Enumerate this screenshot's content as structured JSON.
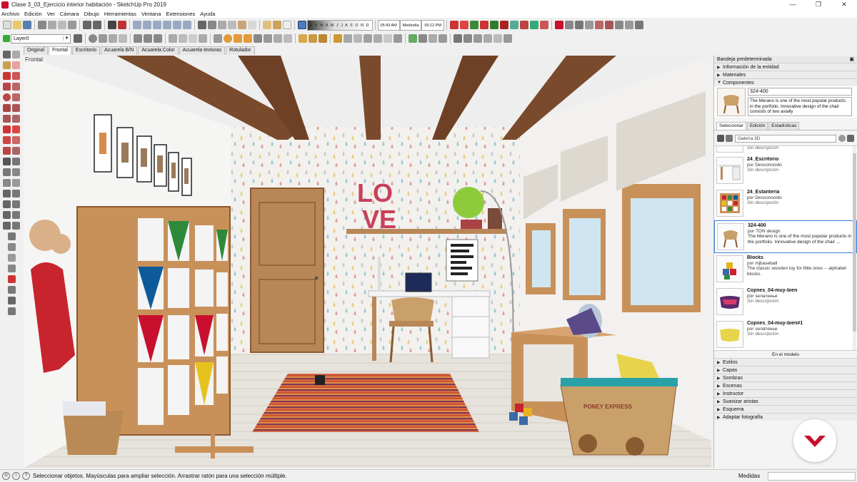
{
  "window": {
    "title": "Clase 3_03_Ejercicio interior habitación - SketchUp Pro 2019",
    "buttons": [
      "—",
      "❐",
      "✕"
    ]
  },
  "menu": [
    "Archivo",
    "Edición",
    "Ver",
    "Cámara",
    "Dibujo",
    "Herramientas",
    "Ventana",
    "Extensiones",
    "Ayuda"
  ],
  "shadows": {
    "months": "E F M A M J J A S O N D",
    "time_start": "05:43 AM",
    "time_mid": "Mediodía",
    "time_end": "06:12 PM"
  },
  "layer": {
    "value": "Layer0"
  },
  "style_tabs": [
    "Original",
    "Frontal",
    "Escritorio",
    "Acuarela B/N",
    "Acuarela Color",
    "Acuarela texturas",
    "Rotulador"
  ],
  "active_style_tab": "Frontal",
  "scene_label": "Frontal",
  "tray": {
    "title": "Bandeja predeterminada",
    "sections_top": [
      "Información de la entidad",
      "Materiales",
      "Componentes"
    ],
    "component": {
      "name": "324-400",
      "description": "The Merano is one of the most popular products in the portfolio. Innovative design of the chair consists of two axially"
    },
    "subtabs": [
      "Seleccionar",
      "Edición",
      "Estadísticas"
    ],
    "active_subtab": "Seleccionar",
    "search_placeholder": "Galería 3D",
    "items": [
      {
        "name": "",
        "author": "",
        "desc": "Sin descripción"
      },
      {
        "name": "24_Escritorio",
        "author": "por Desconocido",
        "desc": "Sin descripción"
      },
      {
        "name": "24_Estantería",
        "author": "por Desconocido",
        "desc": "Sin descripción"
      },
      {
        "name": "324-400",
        "author": "por TON design",
        "desc": "The Merano is one of the most popular products in the portfolio. Innovative design of the chair ..."
      },
      {
        "name": "Blocks",
        "author": "por mjbaseball",
        "desc": "The classic wooden toy for little ones -- alphabet blocks."
      },
      {
        "name": "Cojines_04-muy-bien",
        "author": "por seлатенье",
        "desc": "Sin descripción"
      },
      {
        "name": "Cojines_04-muy-bien#1",
        "author": "por seлатенье",
        "desc": "Sin descripción"
      }
    ],
    "footer": "En el modelo",
    "sections_bottom": [
      "Estilos",
      "Capas",
      "Sombras",
      "Escenas",
      "Instructor",
      "Suavizar aristas",
      "Esquema",
      "Adaptar fotografía"
    ]
  },
  "status": {
    "text": "Seleccionar objetos. Mayúsculas para ampliar selección. Arrastrar ratón para una selección múltiple.",
    "measure_label": "Medidas"
  },
  "scene_text": {
    "love_top": "LO",
    "love_bottom": "VE",
    "cart": "PONEY EXPRESS"
  },
  "colors": {
    "accent_red": "#c8102e",
    "selection_blue": "#3a7bd5",
    "wall": "#f3f1ee",
    "wood": "#b07d4a",
    "beam": "#7a4a2c"
  }
}
